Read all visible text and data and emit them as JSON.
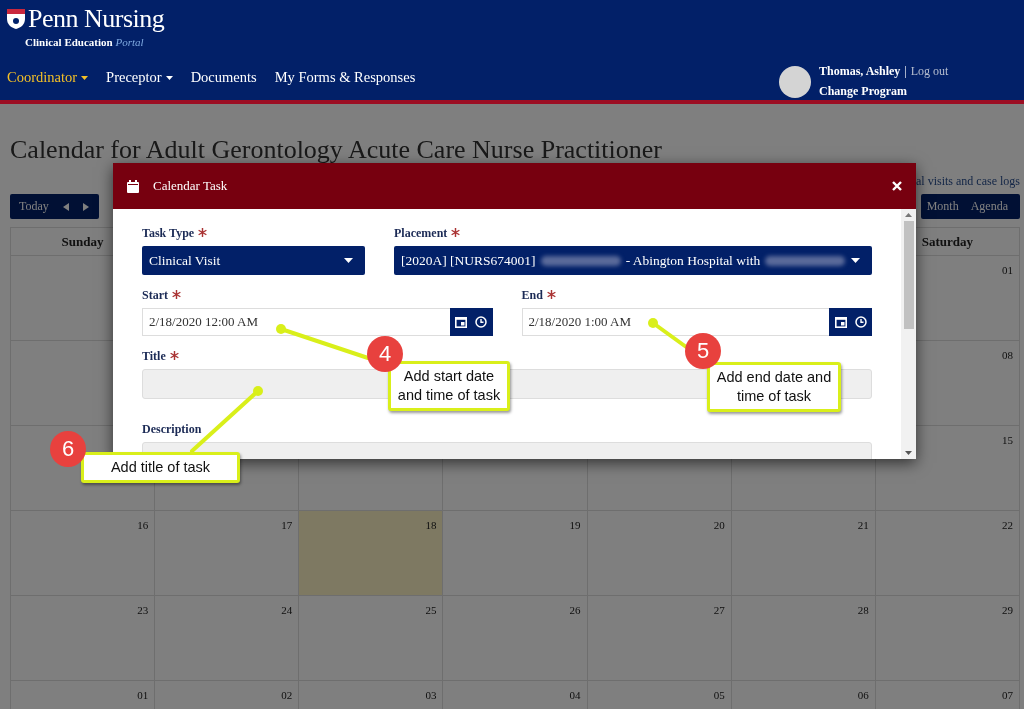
{
  "header": {
    "logo_title": "Penn Nursing",
    "logo_subtitle": "Clinical Education",
    "logo_subtitle_accent": "Portal",
    "nav": [
      {
        "label": "Coordinator",
        "dropdown": true,
        "selected": true
      },
      {
        "label": "Preceptor",
        "dropdown": true,
        "selected": false
      },
      {
        "label": "Documents",
        "dropdown": false,
        "selected": false
      },
      {
        "label": "My Forms & Responses",
        "dropdown": false,
        "selected": false
      }
    ],
    "user": {
      "name": "Thomas, Ashley",
      "separator": "|",
      "logout": "Log out",
      "change_program": "Change Program"
    }
  },
  "page": {
    "title": "Calendar for Adult Gerontology Acute Care Nurse Practitioner",
    "toolbar": {
      "today": "Today",
      "link": "al visits and case logs",
      "views": [
        {
          "label": "Month",
          "selected": false
        },
        {
          "label": "Agenda",
          "selected": false
        }
      ]
    },
    "weekdays": [
      "Sunday",
      "Saturday"
    ],
    "weeks": [
      {
        "days": [
          {
            "date": "01",
            "today": false
          }
        ]
      },
      {
        "days": [
          {
            "date": "08",
            "today": false
          }
        ]
      },
      {
        "days": [
          {
            "date": "15",
            "today": false
          }
        ]
      },
      {
        "days": [
          {
            "date": "16",
            "today": false
          },
          {
            "date": "17",
            "today": false
          },
          {
            "date": "18",
            "today": true
          },
          {
            "date": "19",
            "today": false
          },
          {
            "date": "20",
            "today": false
          },
          {
            "date": "21",
            "today": false
          },
          {
            "date": "22",
            "today": false
          }
        ]
      },
      {
        "days": [
          {
            "date": "23",
            "today": false
          },
          {
            "date": "24",
            "today": false
          },
          {
            "date": "25",
            "today": false
          },
          {
            "date": "26",
            "today": false
          },
          {
            "date": "27",
            "today": false
          },
          {
            "date": "28",
            "today": false
          },
          {
            "date": "29",
            "today": false
          }
        ]
      },
      {
        "days": [
          {
            "date": "01",
            "today": false
          },
          {
            "date": "02",
            "today": false
          },
          {
            "date": "03",
            "today": false
          },
          {
            "date": "04",
            "today": false
          },
          {
            "date": "05",
            "today": false
          },
          {
            "date": "06",
            "today": false
          },
          {
            "date": "07",
            "today": false
          }
        ]
      }
    ]
  },
  "modal": {
    "title": "Calendar Task",
    "task_type": {
      "label": "Task Type",
      "required": true,
      "value": "Clinical Visit"
    },
    "placement": {
      "label": "Placement",
      "required": true,
      "segments": [
        {
          "kind": "text",
          "text": "[2020A] [NURS674001]"
        },
        {
          "kind": "redacted"
        },
        {
          "kind": "text",
          "text": "- Abington Hospital with"
        },
        {
          "kind": "redacted"
        }
      ]
    },
    "start": {
      "label": "Start",
      "required": true,
      "value": "2/18/2020 12:00 AM"
    },
    "end": {
      "label": "End",
      "required": true,
      "value": "2/18/2020 1:00 AM"
    },
    "title_field": {
      "label": "Title",
      "required": true
    },
    "description": {
      "label": "Description",
      "required": false
    }
  },
  "annotations": [
    {
      "number": "4",
      "text": "Add start date and time of task"
    },
    {
      "number": "5",
      "text": "Add end date and time of task"
    },
    {
      "number": "6",
      "text": "Add title of task"
    }
  ]
}
